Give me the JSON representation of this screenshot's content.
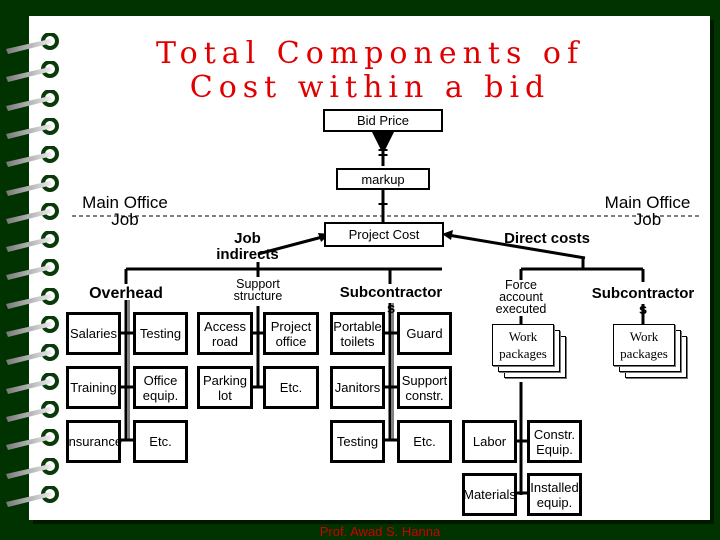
{
  "title": {
    "line1": "Total Components of",
    "line2": "Cost within a bid",
    "color": "#e00000"
  },
  "top_chain": {
    "bid_price": "Bid Price",
    "equals": "=",
    "markup": "markup",
    "plus": "+",
    "project_cost": "Project Cost"
  },
  "zones": {
    "left": {
      "upper": "Main Office",
      "lower": "Job"
    },
    "right": {
      "upper": "Main Office",
      "lower": "Job"
    }
  },
  "job_indirects": {
    "label": "Job indirects",
    "overhead": {
      "label": "Overhead",
      "items": [
        "Salaries",
        "Testing",
        "Training",
        "Office equip.",
        "Insurance",
        "Etc."
      ]
    },
    "support_structure": {
      "label": "Support structure",
      "items": [
        "Access road",
        "Project office",
        "Parking lot",
        "Etc."
      ]
    },
    "subcontractors": {
      "label": "Subcontractors",
      "items": [
        "Portable toilets",
        "Guard",
        "Janitors",
        "Support constr.",
        "Testing",
        "Etc."
      ]
    }
  },
  "direct_costs": {
    "label": "Direct costs",
    "force_account": {
      "label": "Force account executed",
      "work_packages": "Work packages",
      "items": [
        "Labor",
        "Constr. Equip.",
        "Materials",
        "Installed equip."
      ]
    },
    "subcontractors": {
      "label": "Subcontractors",
      "work_packages": "Work packages"
    }
  },
  "footer": {
    "author": "Prof. Awad S. Hanna",
    "color": "#cc0000"
  }
}
